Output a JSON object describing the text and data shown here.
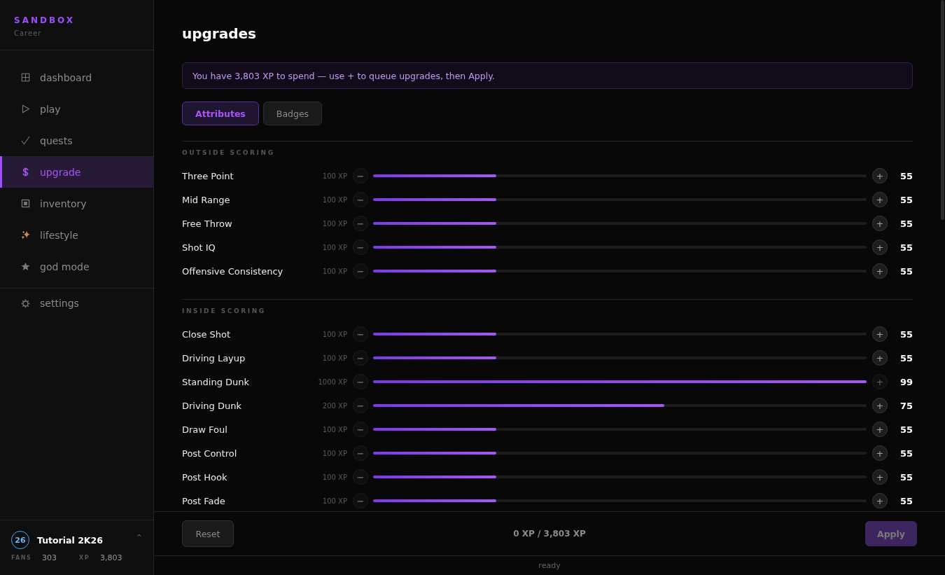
{
  "sidebar": {
    "brand": "SANDBOX",
    "subtitle": "Career",
    "nav": [
      {
        "label": "dashboard",
        "selected": false
      },
      {
        "label": "play",
        "selected": false
      },
      {
        "label": "quests",
        "selected": false
      },
      {
        "label": "upgrade",
        "selected": true
      },
      {
        "label": "inventory",
        "selected": false
      },
      {
        "label": "lifestyle",
        "selected": false
      },
      {
        "label": "god mode",
        "selected": false
      }
    ],
    "secondary_nav": [
      {
        "label": "settings",
        "selected": false
      }
    ],
    "profile": {
      "badge": "26",
      "name": "Tutorial 2K26",
      "toggle": "^",
      "stats": [
        {
          "label": "FANS",
          "value": "303"
        },
        {
          "label": "XP",
          "value": "3,803"
        }
      ]
    }
  },
  "main": {
    "title": "upgrades",
    "banner": "You have 3,803 XP to spend — use + to queue upgrades, then Apply.",
    "tabs": [
      {
        "label": "Attributes",
        "selected": true
      },
      {
        "label": "Badges",
        "selected": false
      }
    ],
    "sections": [
      {
        "title": "OUTSIDE SCORING",
        "rows": [
          {
            "name": "Three Point",
            "cost": "100 XP",
            "level": 0.25,
            "value": "55",
            "minus": {
              "label": "−",
              "disabled": true
            },
            "plus": {
              "label": "+",
              "disabled": false
            }
          },
          {
            "name": "Mid Range",
            "cost": "100 XP",
            "level": 0.25,
            "value": "55",
            "minus": {
              "label": "−",
              "disabled": true
            },
            "plus": {
              "label": "+",
              "disabled": false
            }
          },
          {
            "name": "Free Throw",
            "cost": "100 XP",
            "level": 0.25,
            "value": "55",
            "minus": {
              "label": "−",
              "disabled": true
            },
            "plus": {
              "label": "+",
              "disabled": false
            }
          },
          {
            "name": "Shot IQ",
            "cost": "100 XP",
            "level": 0.25,
            "value": "55",
            "minus": {
              "label": "−",
              "disabled": true
            },
            "plus": {
              "label": "+",
              "disabled": false
            }
          },
          {
            "name": "Offensive Consistency",
            "cost": "100 XP",
            "level": 0.25,
            "value": "55",
            "minus": {
              "label": "−",
              "disabled": true
            },
            "plus": {
              "label": "+",
              "disabled": false
            }
          }
        ]
      },
      {
        "title": "INSIDE SCORING",
        "rows": [
          {
            "name": "Close Shot",
            "cost": "100 XP",
            "level": 0.25,
            "value": "55",
            "minus": {
              "label": "−",
              "disabled": true
            },
            "plus": {
              "label": "+",
              "disabled": false
            }
          },
          {
            "name": "Driving Layup",
            "cost": "100 XP",
            "level": 0.25,
            "value": "55",
            "minus": {
              "label": "−",
              "disabled": true
            },
            "plus": {
              "label": "+",
              "disabled": false
            }
          },
          {
            "name": "Standing Dunk",
            "cost": "1000 XP",
            "level": 1,
            "value": "99",
            "minus": {
              "label": "−",
              "disabled": true
            },
            "plus": {
              "label": "+",
              "disabled": true
            }
          },
          {
            "name": "Driving Dunk",
            "cost": "200 XP",
            "level": 0.59,
            "value": "75",
            "minus": {
              "label": "−",
              "disabled": true
            },
            "plus": {
              "label": "+",
              "disabled": false
            }
          },
          {
            "name": "Draw Foul",
            "cost": "100 XP",
            "level": 0.25,
            "value": "55",
            "minus": {
              "label": "−",
              "disabled": true
            },
            "plus": {
              "label": "+",
              "disabled": false
            }
          },
          {
            "name": "Post Control",
            "cost": "100 XP",
            "level": 0.25,
            "value": "55",
            "minus": {
              "label": "−",
              "disabled": true
            },
            "plus": {
              "label": "+",
              "disabled": false
            }
          },
          {
            "name": "Post Hook",
            "cost": "100 XP",
            "level": 0.25,
            "value": "55",
            "minus": {
              "label": "−",
              "disabled": true
            },
            "plus": {
              "label": "+",
              "disabled": false
            }
          },
          {
            "name": "Post Fade",
            "cost": "100 XP",
            "level": 0.25,
            "value": "55",
            "minus": {
              "label": "−",
              "disabled": true
            },
            "plus": {
              "label": "+",
              "disabled": false
            }
          }
        ]
      }
    ],
    "footer": {
      "reset": "Reset",
      "total": "0 XP / 3,803 XP",
      "apply": {
        "label": "Apply",
        "disabled": true
      }
    }
  },
  "status_bar": "ready"
}
